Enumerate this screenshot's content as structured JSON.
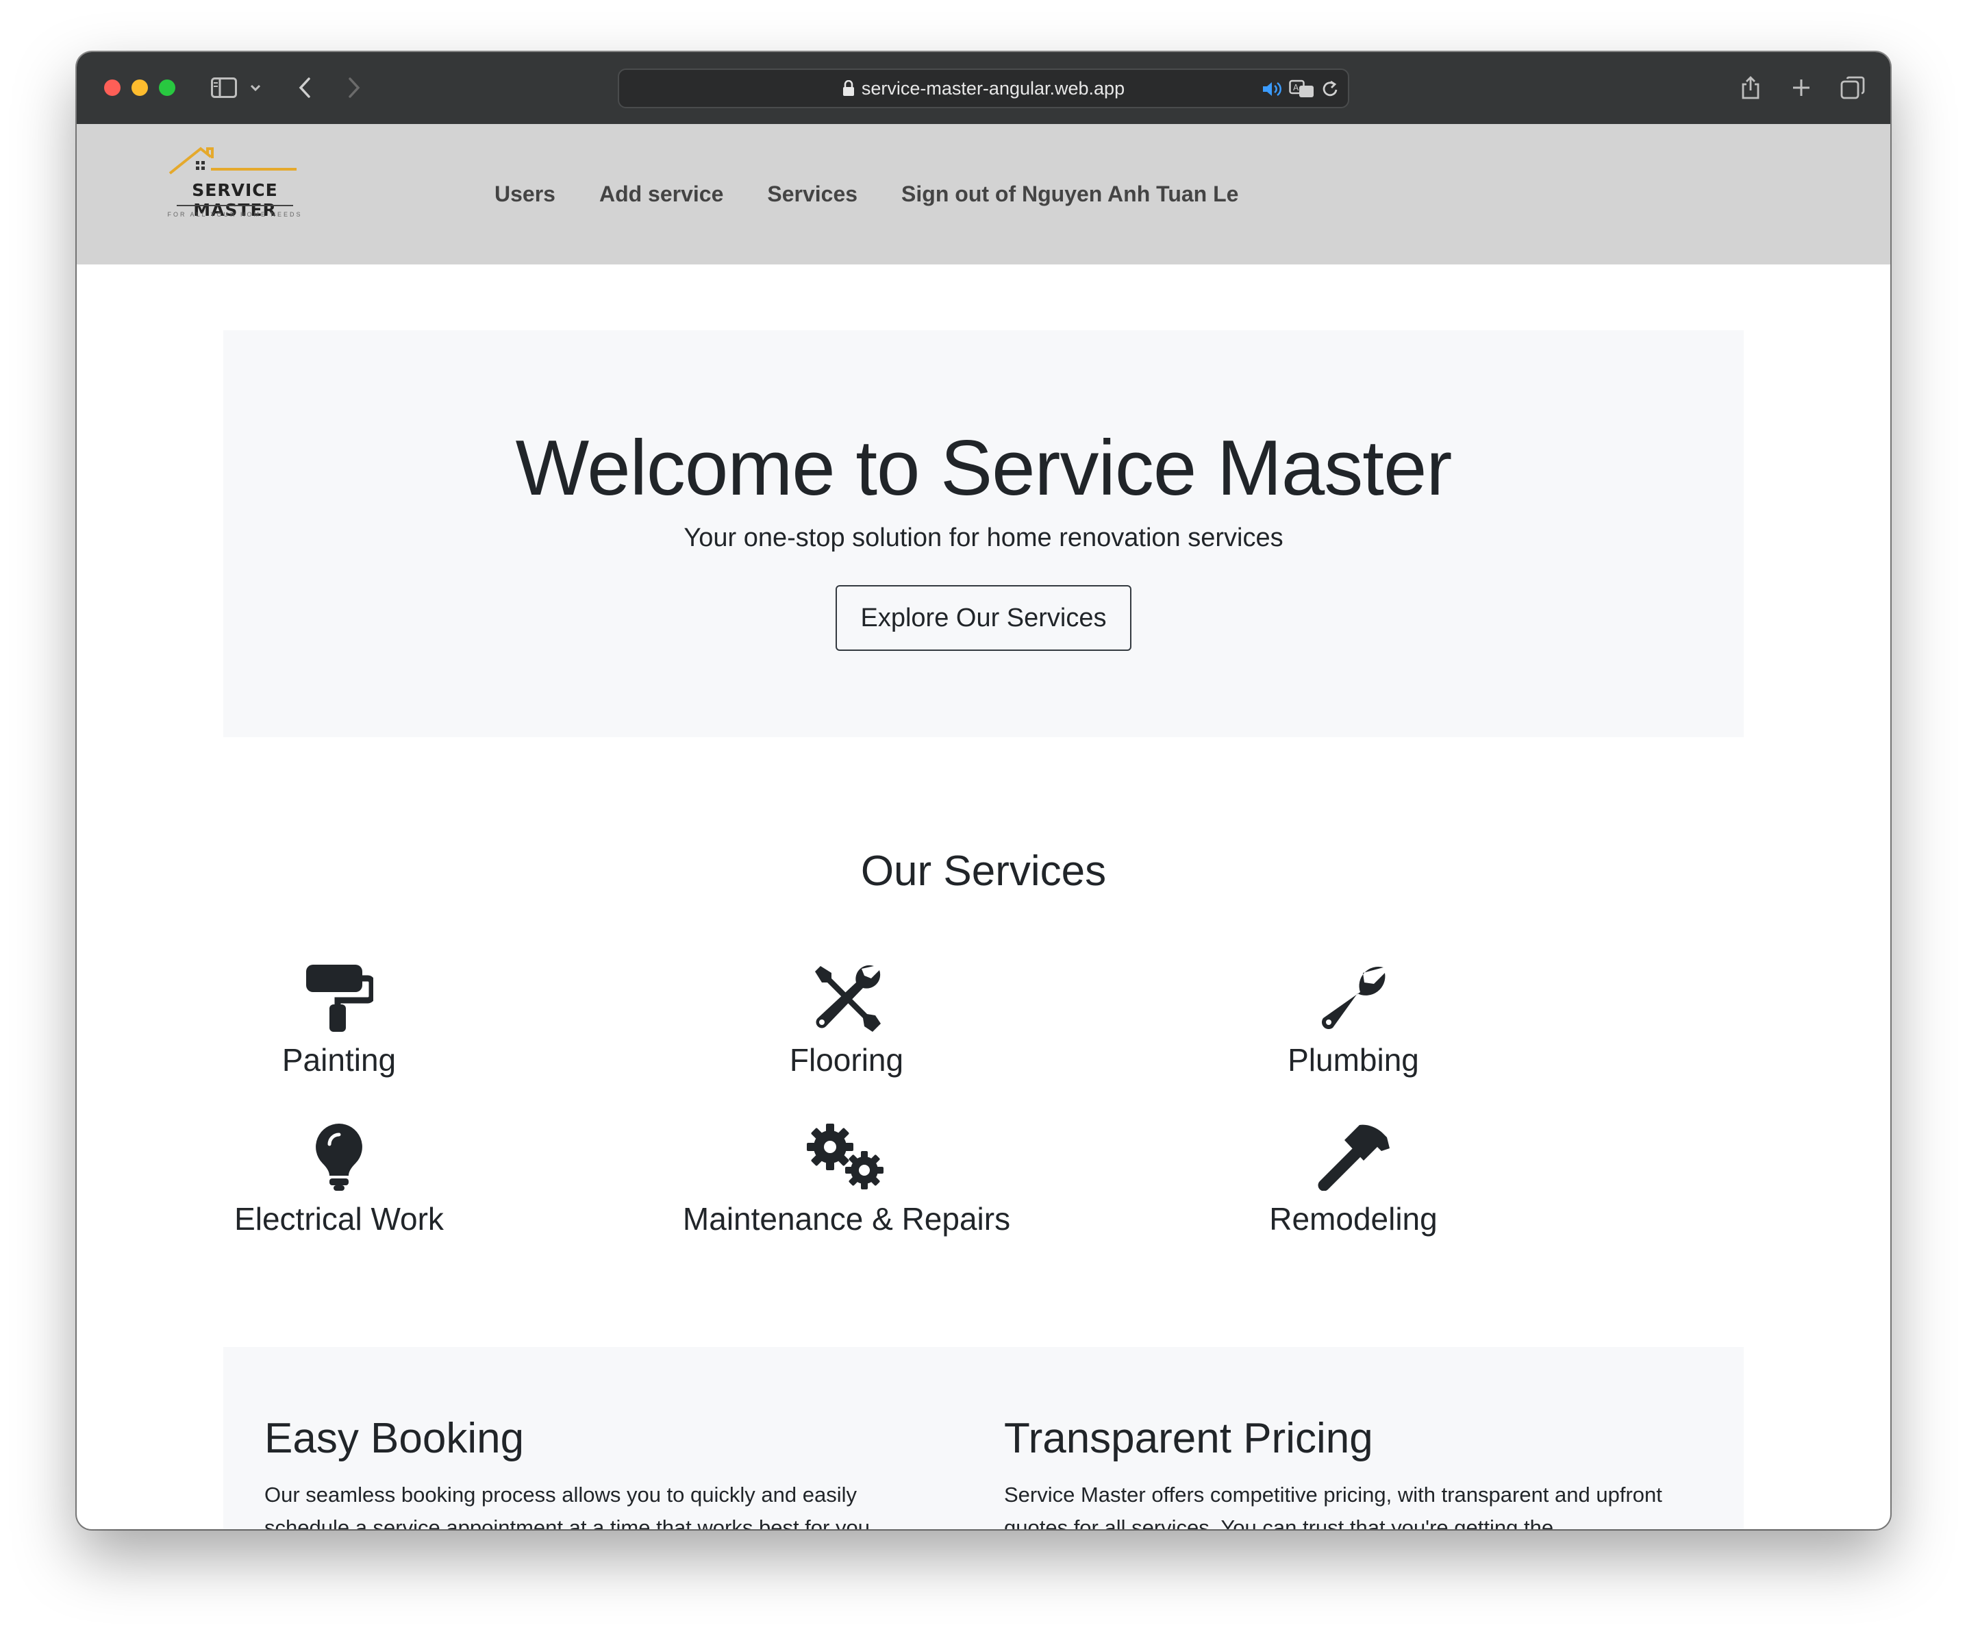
{
  "browser": {
    "url": "service-master-angular.web.app"
  },
  "header": {
    "logo": {
      "name": "SERVICE MASTER",
      "tagline": "FOR ALL YOUR HOME NEEDS",
      "accent_color": "#e5a92c"
    },
    "nav": [
      {
        "label": "Users"
      },
      {
        "label": "Add service"
      },
      {
        "label": "Services"
      },
      {
        "label": "Sign out of Nguyen Anh Tuan Le"
      }
    ]
  },
  "hero": {
    "title": "Welcome to Service Master",
    "subtitle": "Your one-stop solution for home renovation services",
    "button_label": "Explore Our Services"
  },
  "services": {
    "title": "Our Services",
    "items": [
      {
        "label": "Painting",
        "icon": "paint-roller-icon"
      },
      {
        "label": "Flooring",
        "icon": "tools-icon"
      },
      {
        "label": "Plumbing",
        "icon": "wrench-icon"
      },
      {
        "label": "Electrical Work",
        "icon": "lightbulb-icon"
      },
      {
        "label": "Maintenance & Repairs",
        "icon": "gears-icon"
      },
      {
        "label": "Remodeling",
        "icon": "hammer-icon"
      }
    ]
  },
  "features": [
    {
      "title": "Easy Booking",
      "text": "Our seamless booking process allows you to quickly and easily schedule a service appointment at a time that works best for you."
    },
    {
      "title": "Transparent Pricing",
      "text": "Service Master offers competitive pricing, with transparent and upfront quotes for all services. You can trust that you're getting the"
    }
  ]
}
